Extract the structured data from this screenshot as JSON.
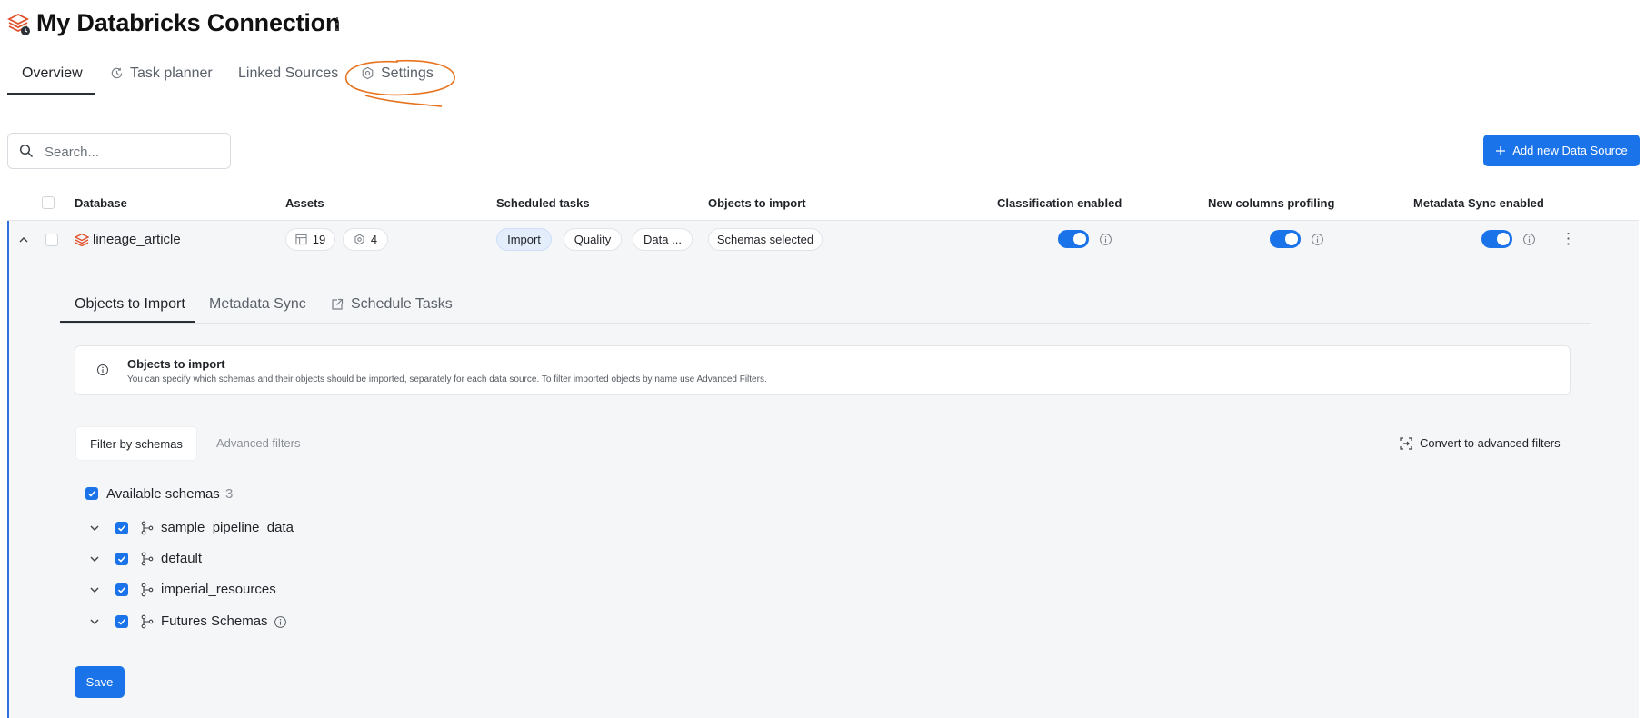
{
  "header": {
    "title": "My Databricks Connection",
    "logo_icon": "databricks-logo-icon",
    "menu_icon": "kebab-vertical-icon"
  },
  "tabs": [
    {
      "label": "Overview",
      "active": true
    },
    {
      "label": "Task planner",
      "icon": "clock-refresh-icon"
    },
    {
      "label": "Linked Sources"
    },
    {
      "label": "Settings",
      "icon": "gear-icon"
    }
  ],
  "search": {
    "placeholder": "Search..."
  },
  "add_button": {
    "label": "Add new Data Source",
    "icon": "plus-icon"
  },
  "table": {
    "columns": [
      "Database",
      "Assets",
      "Scheduled tasks",
      "Objects to import",
      "Classification enabled",
      "New columns profiling",
      "Metadata Sync enabled"
    ],
    "row": {
      "database": "lineage_article",
      "assets_tables": "19",
      "assets_other": "4",
      "tasks": [
        "Import",
        "Quality",
        "Data ..."
      ],
      "objects_to_import": "Schemas selected",
      "classification_enabled": true,
      "new_columns_profiling": true,
      "metadata_sync_enabled": true
    }
  },
  "inner_tabs": [
    {
      "label": "Objects to Import",
      "active": true
    },
    {
      "label": "Metadata Sync"
    },
    {
      "label": "Schedule Tasks",
      "icon": "external-link-icon"
    }
  ],
  "info_card": {
    "title": "Objects to import",
    "description": "You can specify which schemas and their objects should be imported, separately for each data source. To filter imported objects by name use Advanced Filters."
  },
  "filter_tabs": {
    "active": "Filter by schemas",
    "inactive": "Advanced filters"
  },
  "convert_link": "Convert to advanced filters",
  "schemas": {
    "header_label": "Available schemas",
    "count": "3",
    "items": [
      {
        "name": "sample_pipeline_data"
      },
      {
        "name": "default"
      },
      {
        "name": "imperial_resources"
      },
      {
        "name": "Futures Schemas",
        "info": true
      }
    ]
  },
  "save_button": "Save",
  "colors": {
    "accent": "#1a73e8",
    "annotation": "#e8731f",
    "row_border": "#2f6fe0"
  }
}
